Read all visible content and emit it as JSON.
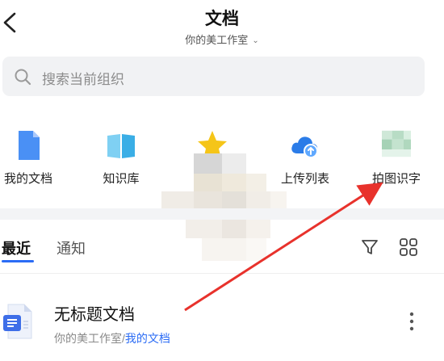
{
  "header": {
    "title": "文档",
    "subtitle": "你的美工作室"
  },
  "search": {
    "placeholder": "搜索当前组织"
  },
  "quick_actions": [
    {
      "label": "我的文档",
      "icon": "my-docs-icon",
      "color": "#4a90f5"
    },
    {
      "label": "知识库",
      "icon": "knowledge-base-icon",
      "color": "#3aaee6"
    },
    {
      "label": "",
      "icon": "star-icon",
      "color": "#f5c518"
    },
    {
      "label": "上传列表",
      "icon": "upload-list-icon",
      "color": "#2b7ce8"
    },
    {
      "label": "拍图识字",
      "icon": "photo-ocr-icon",
      "color": "#a9d6b8"
    }
  ],
  "tabs": {
    "recent": "最近",
    "notify": "通知"
  },
  "recent_doc": {
    "title": "无标题文档",
    "path_prefix": "你的美工作室/",
    "path_link": "我的文档"
  },
  "colors": {
    "accent": "#2b6cf5",
    "arrow": "#e8322c"
  }
}
